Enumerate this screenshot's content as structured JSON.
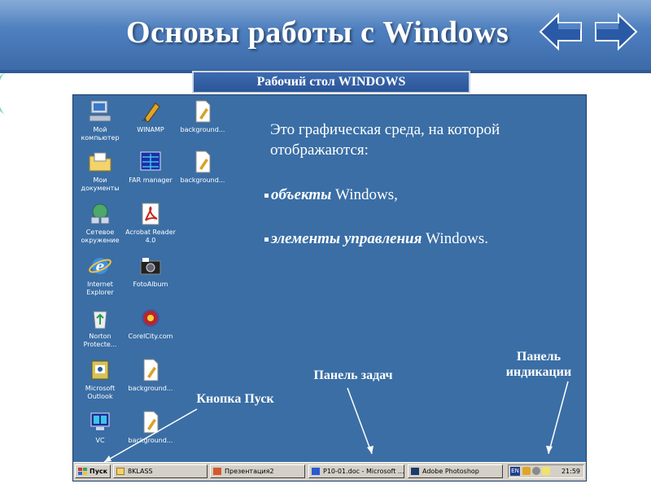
{
  "slide": {
    "title": "Основы работы с Windows",
    "subtitle": "Рабочий стол WINDOWS"
  },
  "desktop": {
    "icons": [
      {
        "label": "Мой компьютер",
        "icon": "my-computer-icon"
      },
      {
        "label": "WINAMP",
        "icon": "winamp-icon"
      },
      {
        "label": "background...",
        "icon": "file-icon"
      },
      {
        "label": "Мои документы",
        "icon": "documents-folder-icon"
      },
      {
        "label": "FAR manager",
        "icon": "far-manager-icon"
      },
      {
        "label": "background...",
        "icon": "file-icon"
      },
      {
        "label": "Сетевое окружение",
        "icon": "network-icon"
      },
      {
        "label": "Acrobat Reader 4.0",
        "icon": "acrobat-icon"
      },
      {
        "label": "Internet Explorer",
        "icon": "internet-explorer-icon"
      },
      {
        "label": "FotoAlbum",
        "icon": "camera-icon"
      },
      {
        "label": "Norton Protecte...",
        "icon": "recycle-bin-icon"
      },
      {
        "label": "CorelCity.com",
        "icon": "corel-icon"
      },
      {
        "label": "Microsoft Outlook",
        "icon": "outlook-icon"
      },
      {
        "label": "background...",
        "icon": "file-icon"
      },
      {
        "label": "VC",
        "icon": "vc-icon"
      },
      {
        "label": "background...",
        "icon": "file-icon"
      }
    ],
    "description": "Это графическая среда, на которой отображаются:",
    "bullets": [
      {
        "bold": "объекты",
        "rest": " Windows,"
      },
      {
        "bold": "элементы управления",
        "rest": " Windows."
      }
    ],
    "callouts": {
      "start": "Кнопка Пуск",
      "taskbar": "Панель задач",
      "tray": "Панель индикации"
    }
  },
  "taskbar": {
    "start_label": "Пуск",
    "tasks": [
      "8KLASS",
      "Презентация2",
      "P10-01.doc - Microsoft ...",
      "Adobe Photoshop"
    ],
    "lang": "EN",
    "clock": "21:59"
  },
  "colors": {
    "header": "#4a7bbb",
    "desktop": "#3a6ea5",
    "taskbar": "#d4d0c8"
  }
}
